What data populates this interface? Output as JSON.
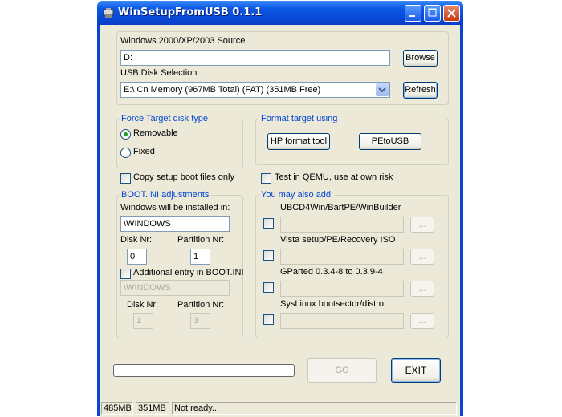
{
  "window": {
    "title": "WinSetupFromUSB 0.1.1",
    "icon": "app-icon"
  },
  "source": {
    "label": "Windows 2000/XP/2003 Source",
    "value": "D:",
    "browse_label": "Browse"
  },
  "usb": {
    "label": "USB Disk Selection",
    "value": "E:\\ Cn Memory (967MB Total) (FAT) (351MB Free)",
    "refresh_label": "Refresh"
  },
  "force_target": {
    "legend": "Force Target disk type",
    "removable_label": "Removable",
    "fixed_label": "Fixed",
    "selected": "Removable"
  },
  "format_target": {
    "legend": "Format target using",
    "hp_label": "HP format tool",
    "petousb_label": "PEtoUSB"
  },
  "copy_setup_label": "Copy setup boot files only",
  "qemu_label": "Test in QEMU, use at own risk",
  "bootini": {
    "legend": "BOOT.INI adjustments",
    "installed_label": "Windows will be installed in:",
    "installed_value": "\\WINDOWS",
    "disk_label": "Disk Nr:",
    "disk_value": "0",
    "partition_label": "Partition Nr:",
    "partition_value": "1",
    "additional_label": "Additional entry in BOOT.INI",
    "additional_value": "\\WINDOWS",
    "disk2_label": "Disk Nr:",
    "disk2_value": "1",
    "partition2_label": "Partition Nr:",
    "partition2_value": "3"
  },
  "also_add": {
    "legend": "You may also add:",
    "items": [
      {
        "label": "UBCD4Win/BartPE/WinBuilder",
        "browse": "..."
      },
      {
        "label": "Vista setup/PE/Recovery ISO",
        "browse": "..."
      },
      {
        "label": "GParted 0.3.4-8 to 0.3.9-4",
        "browse": "..."
      },
      {
        "label": "SysLinux bootsector/distro",
        "browse": "..."
      }
    ]
  },
  "actions": {
    "go_label": "GO",
    "exit_label": "EXIT",
    "progress": 0
  },
  "status_bar": {
    "total": "485MB",
    "free": "351MB",
    "message": "Not ready..."
  },
  "colors": {
    "titlebar": "#0a46d6",
    "face": "#ece9d8",
    "legend": "#0046d5"
  }
}
